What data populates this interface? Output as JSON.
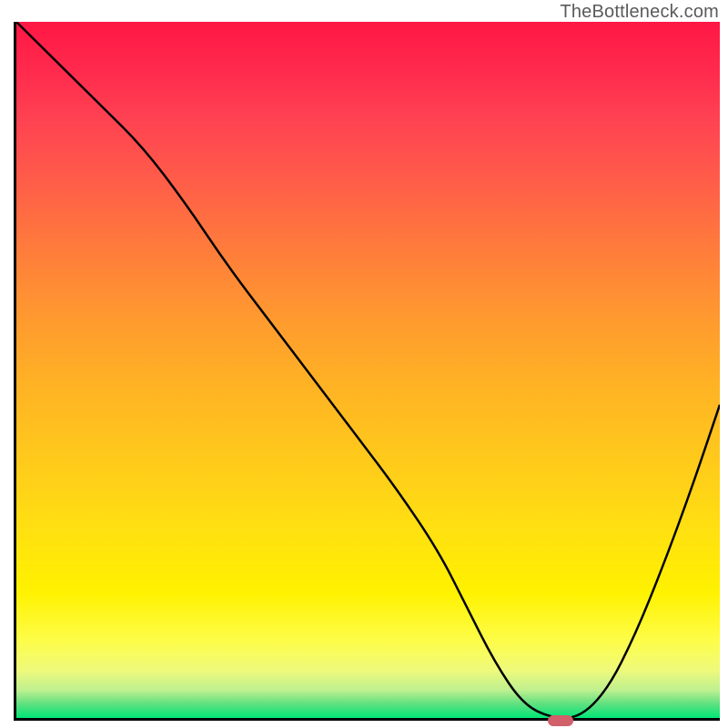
{
  "watermark": "TheBottleneck.com",
  "chart_data": {
    "type": "line",
    "title": "",
    "xlabel": "",
    "ylabel": "",
    "x_range": [
      0,
      100
    ],
    "y_range": [
      0,
      100
    ],
    "background_gradient": {
      "direction": "vertical",
      "stops": [
        {
          "pos": 0,
          "color": "#ff1744"
        },
        {
          "pos": 50,
          "color": "#ffb300"
        },
        {
          "pos": 85,
          "color": "#fff200"
        },
        {
          "pos": 100,
          "color": "#00e676"
        }
      ]
    },
    "series": [
      {
        "name": "bottleneck-curve",
        "color": "#000000",
        "x": [
          0,
          6,
          12,
          18,
          24,
          30,
          36,
          42,
          48,
          54,
          60,
          64,
          68,
          72,
          76,
          80,
          84,
          88,
          92,
          96,
          100
        ],
        "y": [
          100,
          94,
          88,
          82,
          74,
          65,
          57,
          49,
          41,
          33,
          24,
          16,
          8,
          2,
          0,
          0,
          4,
          12,
          22,
          33,
          45
        ]
      }
    ],
    "marker": {
      "name": "optimal-point",
      "x": 77,
      "y": 0,
      "color": "#d1606a",
      "shape": "rounded-rect"
    }
  }
}
